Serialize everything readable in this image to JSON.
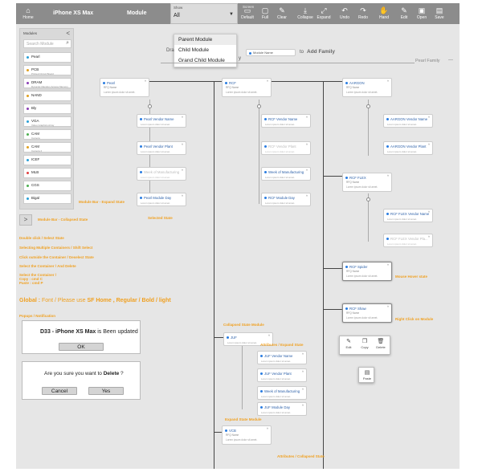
{
  "topbar": {
    "home": "Home",
    "device": "iPhone XS Max",
    "module": "Module",
    "show_caption": "Show",
    "show_value": "All",
    "screen_label": "Screen",
    "default": "Default",
    "full": "Full",
    "clear": "Clear",
    "collapse": "Collapse",
    "expand": "Expand",
    "undo": "Undo",
    "redo": "Redo",
    "hand": "Hand",
    "edit": "Edit",
    "open": "Open",
    "save": "Save"
  },
  "dropdown": [
    "Parent Module",
    "Child Module",
    "Grand Child Module"
  ],
  "drag_hint": {
    "prefix": "Dra",
    "suffix": "y",
    "chip": "Module Name",
    "to": "to",
    "add": "Add Family"
  },
  "pearl_family": "Pearl Family",
  "sidebar": {
    "title": "Modules",
    "search_placeholder": "Search Module",
    "items": [
      {
        "name": "Pearl",
        "sub": "",
        "color": "#2a9fd6"
      },
      {
        "name": "PCB",
        "sub": "Printed Circuit Board",
        "color": "#e0a020"
      },
      {
        "name": "DRAM",
        "sub": "Dynamic Random Access Memory",
        "color": "#8a3fb5"
      },
      {
        "name": "NAND",
        "sub": "",
        "color": "#e0a020"
      },
      {
        "name": "Bly",
        "sub": "",
        "color": "#8a3fb5"
      },
      {
        "name": "VGA",
        "sub": "Video Graphics Array",
        "color": "#2a9fd6"
      },
      {
        "name": "CAM",
        "sub": "Camera",
        "color": "#4caf50"
      },
      {
        "name": "CAM",
        "sub": "Camera 2",
        "color": "#e0a020"
      },
      {
        "name": "ICEF",
        "sub": "",
        "color": "#2a9fd6"
      },
      {
        "name": "MLB",
        "sub": "",
        "color": "#e04040"
      },
      {
        "name": "CGS",
        "sub": "",
        "color": "#4caf50"
      },
      {
        "name": "Bigal",
        "sub": "",
        "color": "#2a9fd6"
      }
    ]
  },
  "labels": {
    "expand_state": "Module Bar - Expand State",
    "collapsed_state": "Module Bar - Collapsed State",
    "selected_state": "Selected State",
    "double_click": "Double click / Select State",
    "multi_select": "Selecting Multiple Containers / Shift Select",
    "deselect": "Click outside the Container / Deselect State",
    "select_delete": "Select the Container / And Delete",
    "select_copy": "Select the Container /",
    "copy": "Copy : cmd C",
    "paste": "Paste : cmd P",
    "global_prefix": "Global :",
    "global_mid": "Font / Please use",
    "global_font": "SF Home , Regular / Bold / light",
    "popups": "Popups / Notification",
    "collapsed_module": "Collapsed State Module",
    "attributes_expand": "Attributes / Expand State",
    "expand_module": "Expand State Module",
    "attributes_collapsed": "Attributes / Collapsed State",
    "mouse_hover": "Mouse Hover state",
    "right_click": "Right Click on Module"
  },
  "notify": {
    "prefix": "D33 - iPhone XS Max",
    "suffix": "is Been updated",
    "ok": "OK"
  },
  "confirm": {
    "prefix": "Are you sure you want to",
    "bold": "Delete",
    "suffix": "?",
    "cancel": "Cancel",
    "yes": "Yes"
  },
  "card_text": {
    "sub": "RFQ Name",
    "line": "Lorem ipsum dolor sit amet.",
    "line2": "Lorem ipsum dolor sit amet."
  },
  "col1": {
    "parent": "Pearl",
    "children": [
      "Pearl Vendor Name",
      "Pearl Vendor Plant",
      "Week of Manufacturing",
      "Pearl Module Day"
    ]
  },
  "col2": {
    "parent": "RCF",
    "children": [
      "RCF Vendor Name",
      "RCF Vendor Plant",
      "Week of Manufacturing",
      "RCF Module Day"
    ]
  },
  "col3": {
    "parent": "AARGON",
    "children": [
      "AARGON Vendor Name",
      "AARGON Vendor Plant"
    ],
    "flex": "RCF FLEX",
    "flex_children": [
      "RCF FLEX Vendor Name",
      "RCF FLEX Vendor Pla..."
    ],
    "spider": "RCF Spider",
    "shaw": "RCF Shaw"
  },
  "col_juf": {
    "parent": "JUF",
    "children": [
      "JUF Vendor Name",
      "JUF Vendor Plant",
      "Week of Manufacturing",
      "JUF Module Day"
    ]
  },
  "vcb": "VCB",
  "context_menu": {
    "edit": "Edit",
    "copy": "Copy",
    "delete": "Delete",
    "paste": "Paste"
  }
}
